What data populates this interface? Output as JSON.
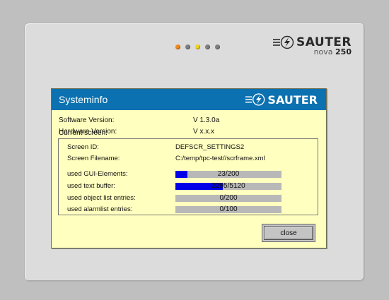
{
  "device": {
    "brand": "SAUTER",
    "model_prefix": "nova",
    "model_number": "250",
    "leds": [
      {
        "color": "#f08a1e"
      },
      {
        "color": "#808080"
      },
      {
        "color": "#f0d41e"
      },
      {
        "color": "#808080"
      },
      {
        "color": "#808080"
      }
    ]
  },
  "dialog": {
    "title": "Systeminfo",
    "logo_text": "SAUTER",
    "software_label": "Software Version:",
    "software_value": "V 1.3.0a",
    "hardware_label": "Hardware Version:",
    "hardware_value": "V x.x.x",
    "current_screen_label": "Current screen:",
    "screen_id_label": "Screen ID:",
    "screen_id_value": "DEFSCR_SETTINGS2",
    "screen_filename_label": "Screen Filename:",
    "screen_filename_value": "C:/temp/tpc-test//scrframe.xml",
    "usage": [
      {
        "label": "used GUI-Elements:",
        "text": "23/200",
        "fraction": 0.115
      },
      {
        "label": "used text buffer:",
        "text": "2295/5120",
        "fraction": 0.448
      },
      {
        "label": "used object list entries:",
        "text": "0/200",
        "fraction": 0
      },
      {
        "label": "used alarmlist entries:",
        "text": "0/100",
        "fraction": 0
      }
    ],
    "close_label": "close"
  },
  "colors": {
    "titlebar": "#0b71b0",
    "dialog_bg": "#ffffbf",
    "bar_fill": "#0000e8",
    "bar_track": "#b8b8b8"
  }
}
